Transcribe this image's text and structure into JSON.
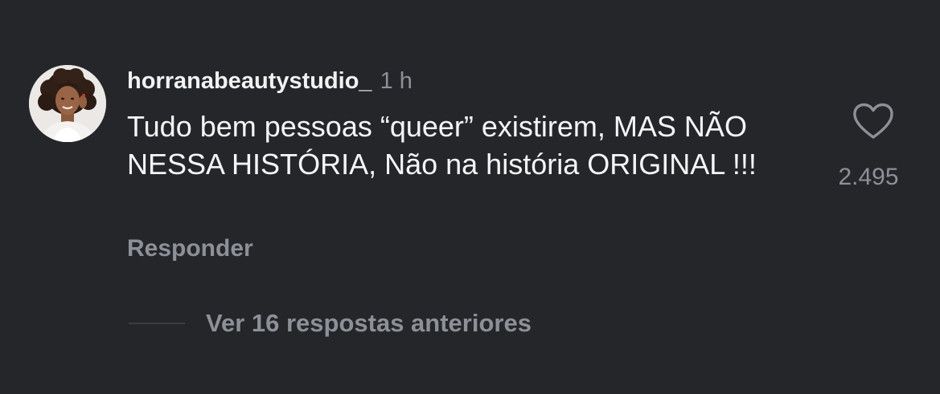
{
  "comment": {
    "username": "horranabeautystudio_",
    "timestamp": "1 h",
    "text": "Tudo bem pessoas “queer” existirem, MAS NÃO NESSA HISTÓRIA, Não na história ORIGINAL !!!",
    "reply_label": "Responder",
    "like_count": "2.495",
    "like_icon": "heart-outline-icon",
    "avatar": "profile-photo"
  },
  "replies": {
    "view_more_label": "Ver 16 respostas anteriores"
  },
  "colors": {
    "background": "#24262a",
    "primary_text": "#f5f5f5",
    "secondary_text": "#8d9097"
  }
}
